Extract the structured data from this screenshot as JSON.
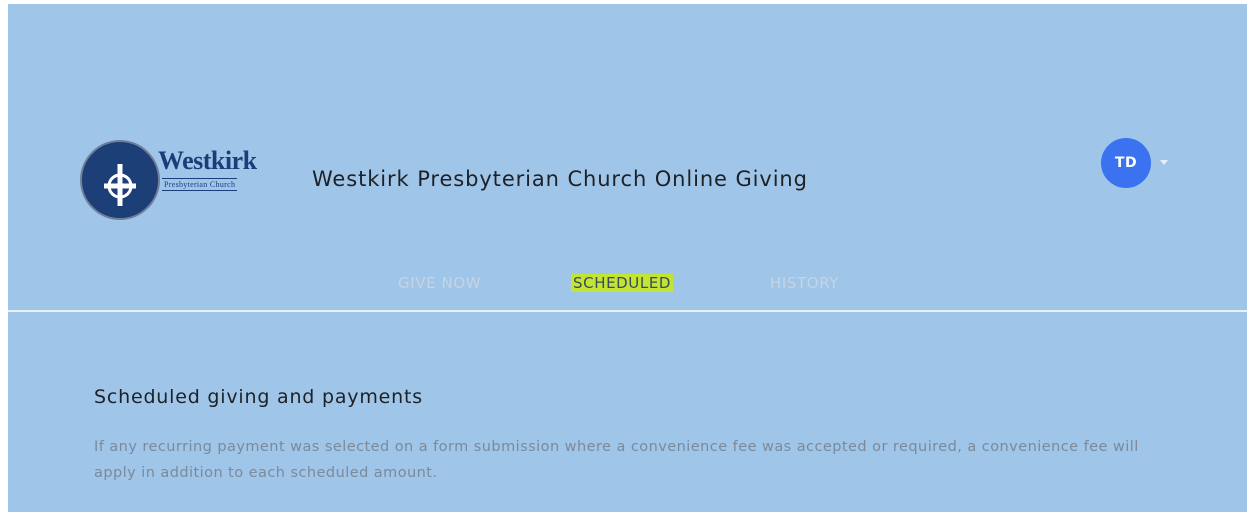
{
  "header": {
    "logo": {
      "word": "Westkirk",
      "subtitle": "Presbyterian Church"
    },
    "site_title": "Westkirk Presbyterian Church Online Giving",
    "user": {
      "initials": "TD"
    }
  },
  "tabs": [
    {
      "label": "GIVE NOW",
      "active": false
    },
    {
      "label": "SCHEDULED",
      "active": true
    },
    {
      "label": "HISTORY",
      "active": false
    }
  ],
  "main": {
    "section_title": "Scheduled giving and payments",
    "section_description": "If any recurring payment was selected on a form submission where a convenience fee was accepted or required, a convenience fee will apply in addition to each scheduled amount."
  },
  "colors": {
    "background": "#9fc5e8",
    "avatar": "#3a72f0",
    "active_tab_highlight": "#c2e534",
    "logo_blue": "#1b3d7a"
  }
}
